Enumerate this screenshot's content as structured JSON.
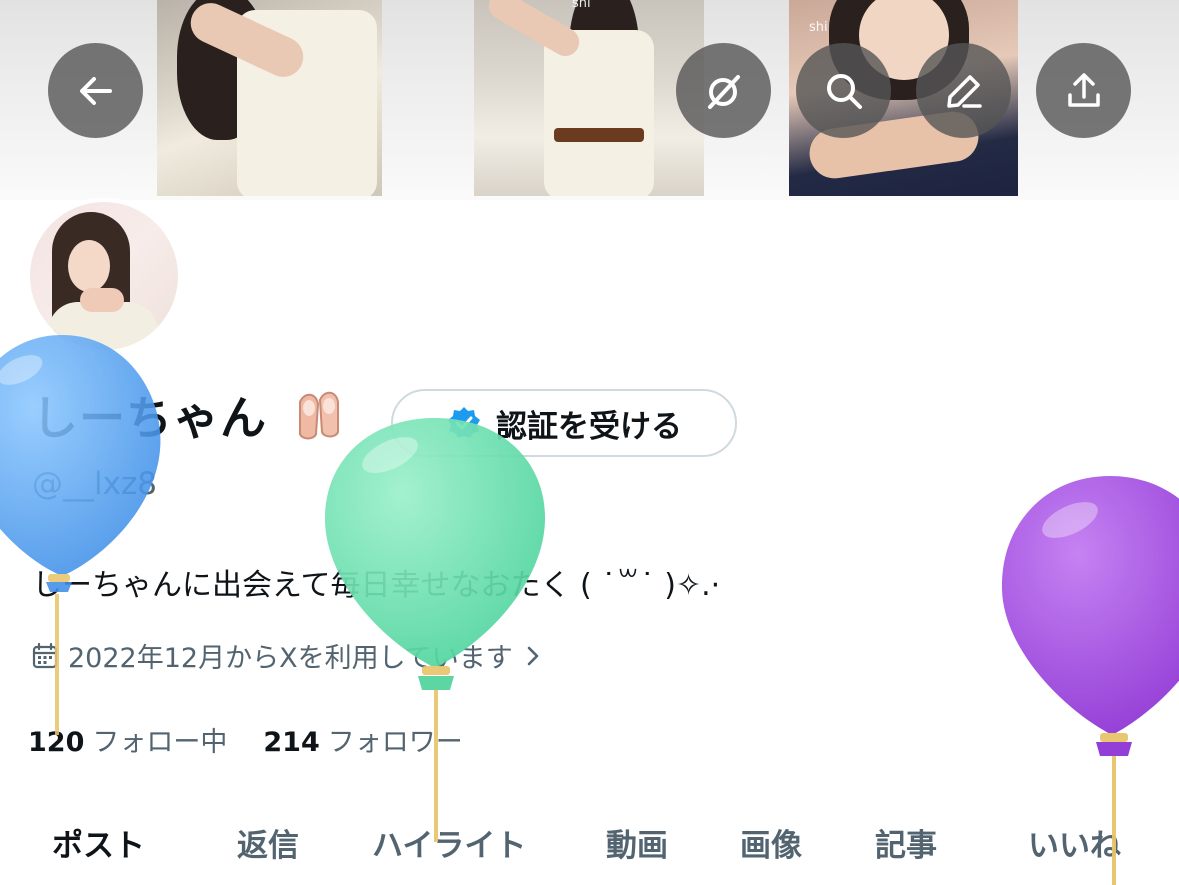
{
  "banner": {
    "photos": [
      {
        "watermark": ""
      },
      {
        "watermark": "shi"
      },
      {
        "watermark": "shi"
      }
    ]
  },
  "header_buttons": [
    {
      "icon": "back-arrow-icon"
    },
    {
      "icon": "grok-icon"
    },
    {
      "icon": "search-icon"
    },
    {
      "icon": "edit-icon"
    },
    {
      "icon": "share-icon"
    }
  ],
  "profile": {
    "name": "しーちゃん",
    "name_emoji": "ballet-shoes",
    "verify_button": "認証を受ける",
    "handle": "@__lxz8",
    "bio": "しーちゃんに出会えて毎日幸せなおたく ( ˙꒳​˙ )✧.·",
    "joined": "2022年12月からXを利用しています",
    "following_count": "120",
    "following_label": "フォロー中",
    "followers_count": "214",
    "followers_label": "フォロワー"
  },
  "tabs": [
    "ポスト",
    "返信",
    "ハイライト",
    "動画",
    "画像",
    "記事",
    "いいね"
  ],
  "active_tab": "ポスト",
  "colors": {
    "text_primary": "#0f1419",
    "text_secondary": "#536471",
    "button_overlay": "#555555",
    "verify_badge": "#1d9bf0",
    "balloon_blue": "#5aaaf6",
    "balloon_green": "#6be3b4",
    "balloon_purple": "#a44ce0"
  }
}
